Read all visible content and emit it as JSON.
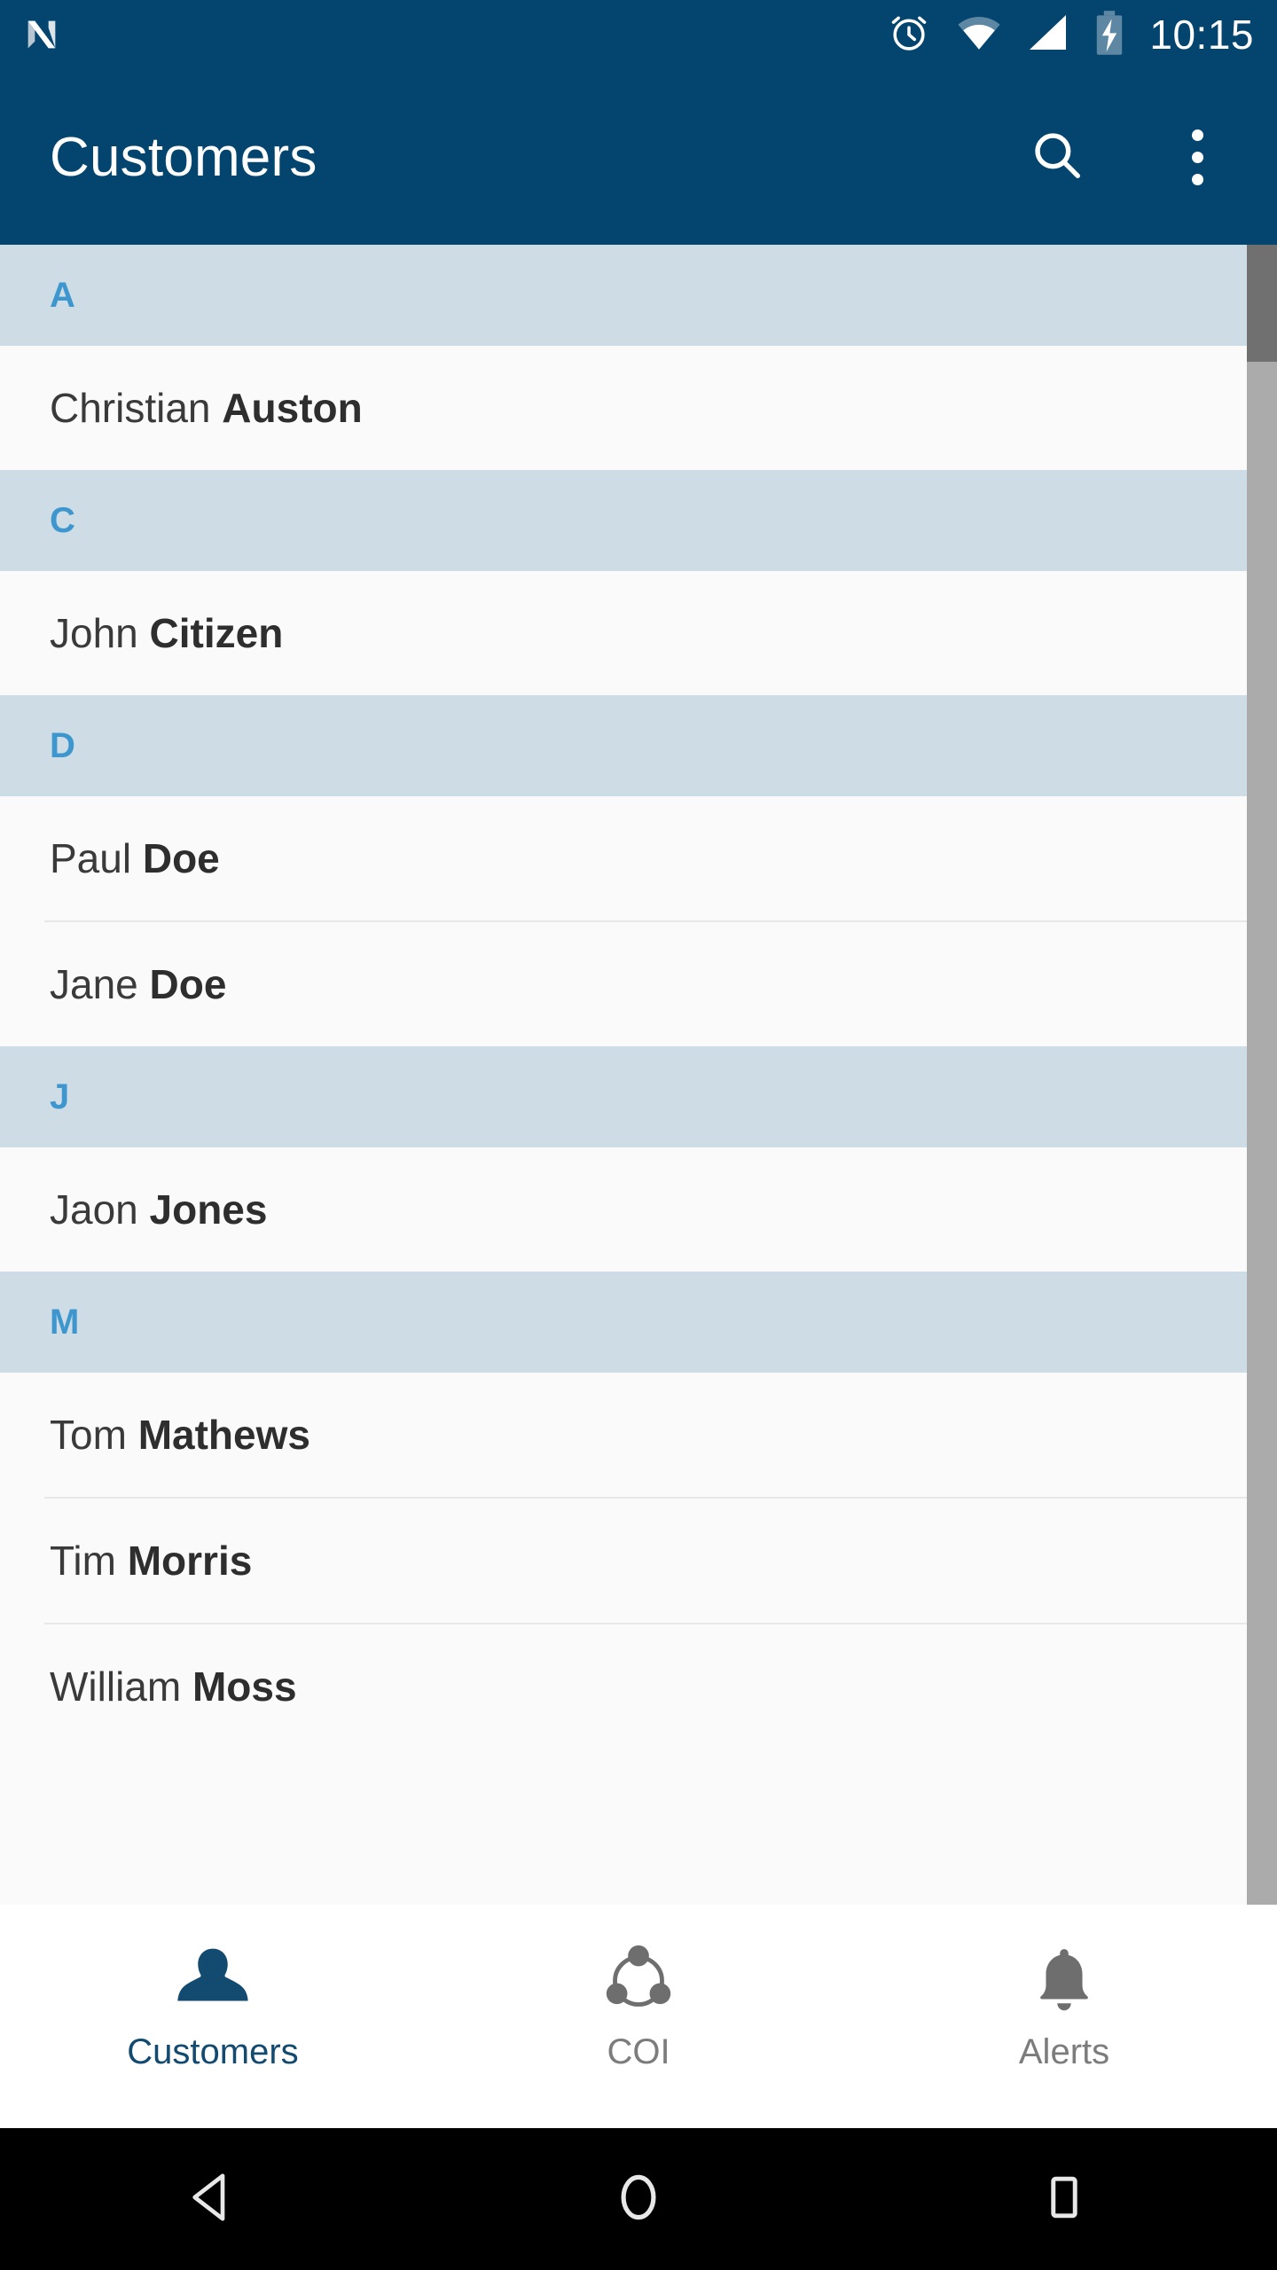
{
  "statusbar": {
    "logo_icon": "android-n-logo",
    "icons": [
      "alarm-icon",
      "wifi-icon",
      "signal-icon",
      "battery-charging-icon"
    ],
    "time": "10:15",
    "colors": {
      "background": "#03456E",
      "foreground": "#FFFFFF"
    }
  },
  "appbar": {
    "title": "Customers",
    "search_icon": "search-icon",
    "overflow_icon": "overflow-menu-icon",
    "colors": {
      "background": "#03456E",
      "title": "#FFFFFF"
    }
  },
  "list": {
    "colors": {
      "section_background": "#CDDCE5",
      "section_letter": "#3D97CE",
      "row_background": "#FAFAFA",
      "row_text": "#3A3A3A",
      "divider": "#E8E8E8"
    },
    "sections": [
      {
        "letter": "A",
        "rows": [
          {
            "first": "Christian ",
            "last": "Auston"
          }
        ]
      },
      {
        "letter": "C",
        "rows": [
          {
            "first": "John ",
            "last": "Citizen"
          }
        ]
      },
      {
        "letter": "D",
        "rows": [
          {
            "first": "Paul ",
            "last": "Doe"
          },
          {
            "first": "Jane ",
            "last": "Doe"
          }
        ]
      },
      {
        "letter": "J",
        "rows": [
          {
            "first": "Jaon ",
            "last": "Jones"
          }
        ]
      },
      {
        "letter": "M",
        "rows": [
          {
            "first": "Tom ",
            "last": "Mathews"
          },
          {
            "first": "Tim ",
            "last": "Morris"
          },
          {
            "first": "William ",
            "last": "Moss"
          }
        ]
      }
    ]
  },
  "scrollbar": {
    "track_color": "#ABABAB",
    "thumb_color": "#707070"
  },
  "bottomnav": {
    "active_color": "#134A70",
    "inactive_color": "#7C7C7C",
    "items": [
      {
        "label": "Customers",
        "icon": "person-icon",
        "active": true
      },
      {
        "label": "COI",
        "icon": "share-network-icon",
        "active": false
      },
      {
        "label": "Alerts",
        "icon": "bell-icon",
        "active": false
      }
    ]
  },
  "androidnav": {
    "background": "#000000",
    "buttons": [
      {
        "icon": "back-triangle-icon"
      },
      {
        "icon": "home-circle-icon"
      },
      {
        "icon": "recents-square-icon"
      }
    ]
  }
}
